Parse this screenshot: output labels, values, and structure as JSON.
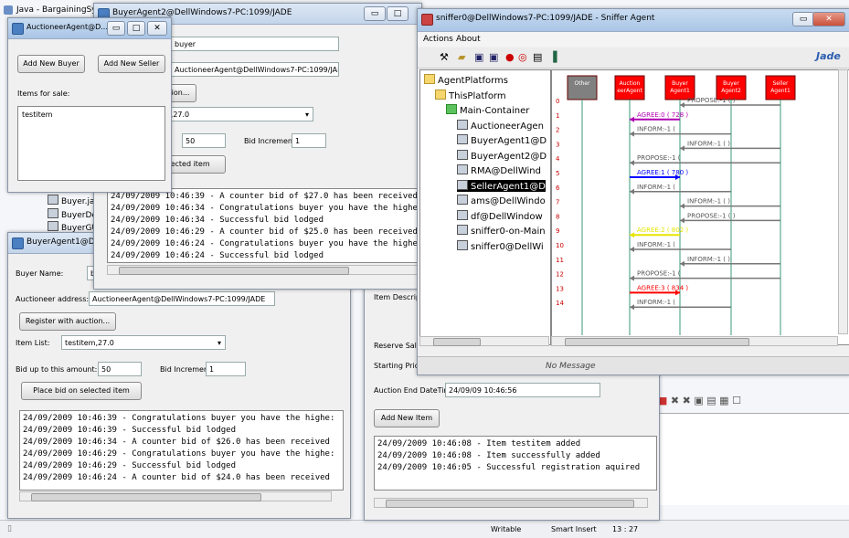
{
  "background_window": {
    "title": "Java - BargainingSystem",
    "tree_items": [
      "Buyer.java",
      "BuyerDeta",
      "BuyerGUI.j"
    ],
    "status": {
      "writable": "Writable",
      "insert": "Smart Insert",
      "position": "13 : 27"
    }
  },
  "auctioneer_small": {
    "title": "AuctioneerAgent@D...",
    "add_buyer": "Add New Buyer",
    "add_seller": "Add New Seller",
    "items_label": "Items for sale:",
    "items": [
      "testitem"
    ]
  },
  "buyer2": {
    "title": "BuyerAgent2@DellWindows7-PC:1099/JADE",
    "name_value": "buyer",
    "auctioneer_value": "AuctioneerAgent@DellWindows7-PC:1099/JADE",
    "register_label": "tion...",
    "item_value": "m,27.0",
    "bid_value": "50",
    "bid_inc_label": "Bid Increment:",
    "bid_inc_value": "1",
    "place_label": "lected item",
    "log": [
      "24/09/2009 10:46:39 - A counter bid of $27.0 has been received",
      "24/09/2009 10:46:34 - Congratulations buyer you have the highe",
      "24/09/2009 10:46:34 - Successful bid lodged",
      "24/09/2009 10:46:29 - A counter bid of $25.0 has been received",
      "24/09/2009 10:46:24 - Congratulations buyer you have the highe",
      "24/09/2009 10:46:24 - Successful bid lodged"
    ]
  },
  "buyer1": {
    "title": "BuyerAgent1@DellW",
    "name_label": "Buyer Name:",
    "name_value": "b",
    "auctioneer_label": "Auctioneer address:",
    "auctioneer_value": "AuctioneerAgent@DellWindows7-PC:1099/JADE",
    "register_label": "Register with auction...",
    "item_label": "Item List:",
    "item_value": "testitem,27.0",
    "bid_label": "Bid up to this amount:",
    "bid_value": "50",
    "bid_inc_label": "Bid Increment:",
    "bid_inc_value": "1",
    "place_label": "Place bid on selected item",
    "log": [
      "24/09/2009 10:46:39 - Congratulations buyer you have the highe:",
      "24/09/2009 10:46:39 - Successful bid lodged",
      "24/09/2009 10:46:34 - A counter bid of $26.0 has been received",
      "24/09/2009 10:46:29 - Congratulations buyer you have the highe:",
      "24/09/2009 10:46:29 - Successful bid lodged",
      "24/09/2009 10:46:24 - A counter bid of $24.0 has been received"
    ]
  },
  "seller": {
    "desc_label": "Item Descripti",
    "reserve_label": "Reserve Sale I",
    "start_label": "Starting Price:",
    "end_label": "Auction End DateTime:",
    "end_value": "24/09/09 10:46:56",
    "add_item": "Add New Item",
    "log": [
      "24/09/2009 10:46:08 - Item testitem added",
      "24/09/2009 10:46:08 - Item successfully added",
      "24/09/2009 10:46:05 - Successful registration aquired"
    ]
  },
  "sniffer": {
    "title": "sniffer0@DellWindows7-PC:1099/JADE - Sniffer Agent",
    "menu": [
      "Actions",
      "About"
    ],
    "tree": [
      {
        "label": "AgentPlatforms",
        "level": 0,
        "kind": "folder"
      },
      {
        "label": "ThisPlatform",
        "level": 1,
        "kind": "folder"
      },
      {
        "label": "Main-Container",
        "level": 2,
        "kind": "folder-g"
      },
      {
        "label": "AuctioneerAgen",
        "level": 3,
        "kind": "agent"
      },
      {
        "label": "BuyerAgent1@D",
        "level": 3,
        "kind": "agent"
      },
      {
        "label": "BuyerAgent2@D",
        "level": 3,
        "kind": "agent"
      },
      {
        "label": "RMA@DellWind",
        "level": 3,
        "kind": "agent"
      },
      {
        "label": "SellerAgent1@D",
        "level": 3,
        "kind": "agent",
        "selected": true
      },
      {
        "label": "ams@DellWindo",
        "level": 3,
        "kind": "agent"
      },
      {
        "label": "df@DellWindow",
        "level": 3,
        "kind": "agent"
      },
      {
        "label": "sniffer0-on-Main",
        "level": 3,
        "kind": "agent"
      },
      {
        "label": "sniffer0@DellWi",
        "level": 3,
        "kind": "agent"
      }
    ],
    "agents": [
      {
        "label": "Other",
        "color": "#808080"
      },
      {
        "label": "Auction eerAgent",
        "color": "#ff0000"
      },
      {
        "label": "Buyer Agent1",
        "color": "#ff0000"
      },
      {
        "label": "Buyer Agent2",
        "color": "#ff0000"
      },
      {
        "label": "Seller Agent1",
        "color": "#ff0000"
      }
    ],
    "row_numbers": [
      "0",
      "1",
      "2",
      "3",
      "4",
      "5",
      "6",
      "7",
      "8",
      "9",
      "10",
      "11",
      "12",
      "13",
      "14"
    ],
    "messages": [
      {
        "label": "PROPOSE:-1 (    )",
        "color": "#777777"
      },
      {
        "label": "AGREE:0 (  728  )",
        "color": "#b000b0"
      },
      {
        "label": "INFORM:-1 (",
        "color": "#777777"
      },
      {
        "label": "INFORM:-1 (    )",
        "color": "#777777"
      },
      {
        "label": "PROPOSE:-1 (",
        "color": "#777777"
      },
      {
        "label": "AGREE:1 (  780  )",
        "color": "#0000ff"
      },
      {
        "label": "INFORM:-1 (",
        "color": "#777777"
      },
      {
        "label": "INFORM:-1 (    )",
        "color": "#777777"
      },
      {
        "label": "PROPOSE:-1 (    )",
        "color": "#777777"
      },
      {
        "label": "AGREE:2 (  802  )",
        "color": "#e6e600"
      },
      {
        "label": "INFORM:-1 (",
        "color": "#777777"
      },
      {
        "label": "INFORM:-1 (    )",
        "color": "#777777"
      },
      {
        "label": "PROPOSE:-1 (",
        "color": "#777777"
      },
      {
        "label": "AGREE:3 (  834  )",
        "color": "#ff0000"
      },
      {
        "label": "INFORM:-1 (",
        "color": "#777777"
      }
    ],
    "status": "No Message",
    "logo": "Jade"
  }
}
